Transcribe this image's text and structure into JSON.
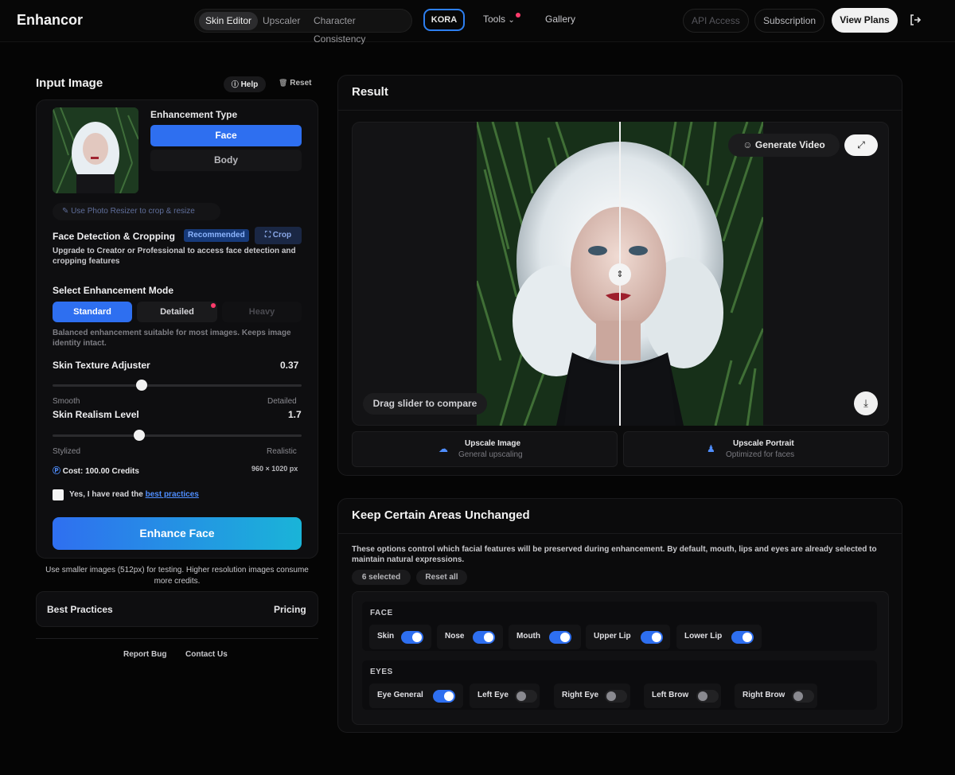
{
  "app": {
    "name": "Enhancor"
  },
  "nav": {
    "tabs": [
      {
        "label": "Skin Editor",
        "active": true
      },
      {
        "label": "Upscaler",
        "active": false
      },
      {
        "label": "Character Consistency",
        "active": false
      }
    ],
    "kora": "KORA",
    "tools": "Tools",
    "gallery": "Gallery",
    "api_access": "API Access",
    "subscription": "Subscription",
    "view_plans": "View Plans"
  },
  "input_panel": {
    "title": "Input Image",
    "help": "Help",
    "reset": "Reset",
    "enhancement_type_label": "Enhancement Type",
    "types": [
      {
        "label": "Face",
        "selected": true
      },
      {
        "label": "Body",
        "selected": false
      }
    ],
    "resizer_link": "Use Photo Resizer to crop & resize",
    "face_detection_title": "Face Detection & Cropping",
    "recommended_badge": "Recommended",
    "crop_button": "Crop",
    "face_detection_note": "Upgrade to Creator or Professional to access face detection and cropping features",
    "mode_title": "Select Enhancement Mode",
    "modes": [
      {
        "label": "Standard",
        "selected": true
      },
      {
        "label": "Detailed",
        "selected": false
      },
      {
        "label": "Heavy",
        "selected": false,
        "disabled": true
      }
    ],
    "mode_description": "Balanced enhancement suitable for most images. Keeps image identity intact.",
    "skin_texture": {
      "label": "Skin Texture Adjuster",
      "value": "0.37",
      "min_label": "Smooth",
      "max_label": "Detailed",
      "position": 0.36
    },
    "skin_realism": {
      "label": "Skin Realism Level",
      "value": "1.7",
      "min_label": "Stylized",
      "max_label": "Realistic",
      "position": 0.35
    },
    "cost": "Cost: 100.00 Credits",
    "dimensions": "960 × 1020 px",
    "agree_prefix": "Yes, I have read the ",
    "agree_link": "best practices",
    "enhance_button": "Enhance Face",
    "note": "Use smaller images (512px) for testing. Higher resolution images consume more credits.",
    "best_practices": "Best Practices",
    "pricing": "Pricing",
    "report_bug": "Report Bug",
    "contact_us": "Contact Us"
  },
  "result": {
    "title": "Result",
    "generate_video": "Generate Video",
    "drag_hint": "Drag slider to compare",
    "compare_position": 0.5,
    "upscale_image": {
      "title": "Upscale Image",
      "subtitle": "General upscaling"
    },
    "upscale_portrait": {
      "title": "Upscale Portrait",
      "subtitle": "Optimized for faces"
    }
  },
  "keep_areas": {
    "title": "Keep Certain Areas Unchanged",
    "description": "These options control which facial features will be preserved during enhancement. By default, mouth, lips and eyes are already selected to maintain natural expressions.",
    "selected_count": "6 selected",
    "reset_all": "Reset all",
    "face_group": "FACE",
    "face_options": [
      {
        "label": "Skin",
        "on": true
      },
      {
        "label": "Nose",
        "on": true
      },
      {
        "label": "Mouth",
        "on": true
      },
      {
        "label": "Upper Lip",
        "on": true
      },
      {
        "label": "Lower Lip",
        "on": true
      }
    ],
    "eyes_group": "EYES",
    "eye_options": [
      {
        "label": "Eye General",
        "on": true
      },
      {
        "label": "Left Eye",
        "on": false
      },
      {
        "label": "Right Eye",
        "on": false
      },
      {
        "label": "Left Brow",
        "on": false
      },
      {
        "label": "Right Brow",
        "on": false
      }
    ]
  },
  "colors": {
    "accent": "#2e6ff0",
    "gradient_end": "#1ab4d8",
    "badge_dot": "#ff3b6b"
  },
  "icons": [
    "help-icon",
    "trash-icon",
    "pencil-icon",
    "crop-icon",
    "coin-icon",
    "chevron-down-icon",
    "logout-icon",
    "smile-icon",
    "expand-icon",
    "swap-vertical-icon",
    "download-icon",
    "cloud-upload-icon",
    "user-icon"
  ]
}
